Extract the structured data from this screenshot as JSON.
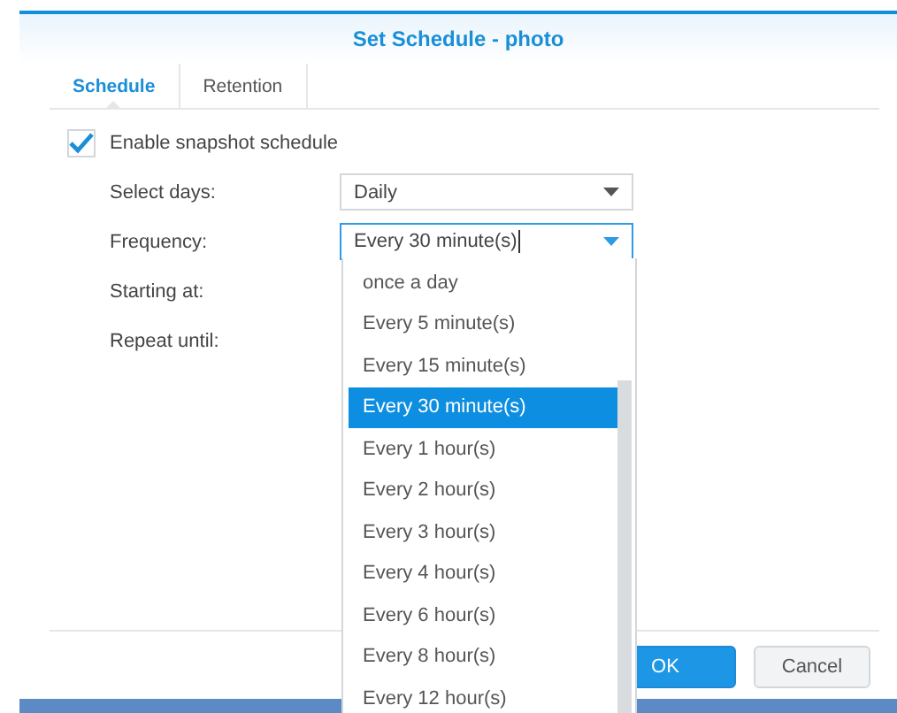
{
  "dialog": {
    "title": "Set Schedule - photo"
  },
  "tabs": [
    {
      "label": "Schedule",
      "selected": true
    },
    {
      "label": "Retention",
      "selected": false
    }
  ],
  "enable_schedule": {
    "label": "Enable snapshot schedule",
    "checked": true
  },
  "fields": [
    {
      "label": "Select days:",
      "kind": "select",
      "value": "Daily",
      "focused": false
    },
    {
      "label": "Frequency:",
      "kind": "select",
      "value": "Every 30 minute(s)",
      "focused": true
    },
    {
      "label": "Starting at:",
      "kind": "hidden"
    },
    {
      "label": "Repeat until:",
      "kind": "hidden"
    }
  ],
  "dropdown": {
    "options": [
      {
        "label": "once a day",
        "selected": false
      },
      {
        "label": "Every 5 minute(s)",
        "selected": false
      },
      {
        "label": "Every 15 minute(s)",
        "selected": false
      },
      {
        "label": "Every 30 minute(s)",
        "selected": true
      },
      {
        "label": "Every 1 hour(s)",
        "selected": false
      },
      {
        "label": "Every 2 hour(s)",
        "selected": false
      },
      {
        "label": "Every 3 hour(s)",
        "selected": false
      },
      {
        "label": "Every 4 hour(s)",
        "selected": false
      },
      {
        "label": "Every 6 hour(s)",
        "selected": false
      },
      {
        "label": "Every 8 hour(s)",
        "selected": false
      },
      {
        "label": "Every 12 hour(s)",
        "selected": false
      }
    ]
  },
  "buttons": [
    {
      "label": "OK",
      "kind": "primary"
    },
    {
      "label": "Cancel",
      "kind": "secondary"
    }
  ]
}
